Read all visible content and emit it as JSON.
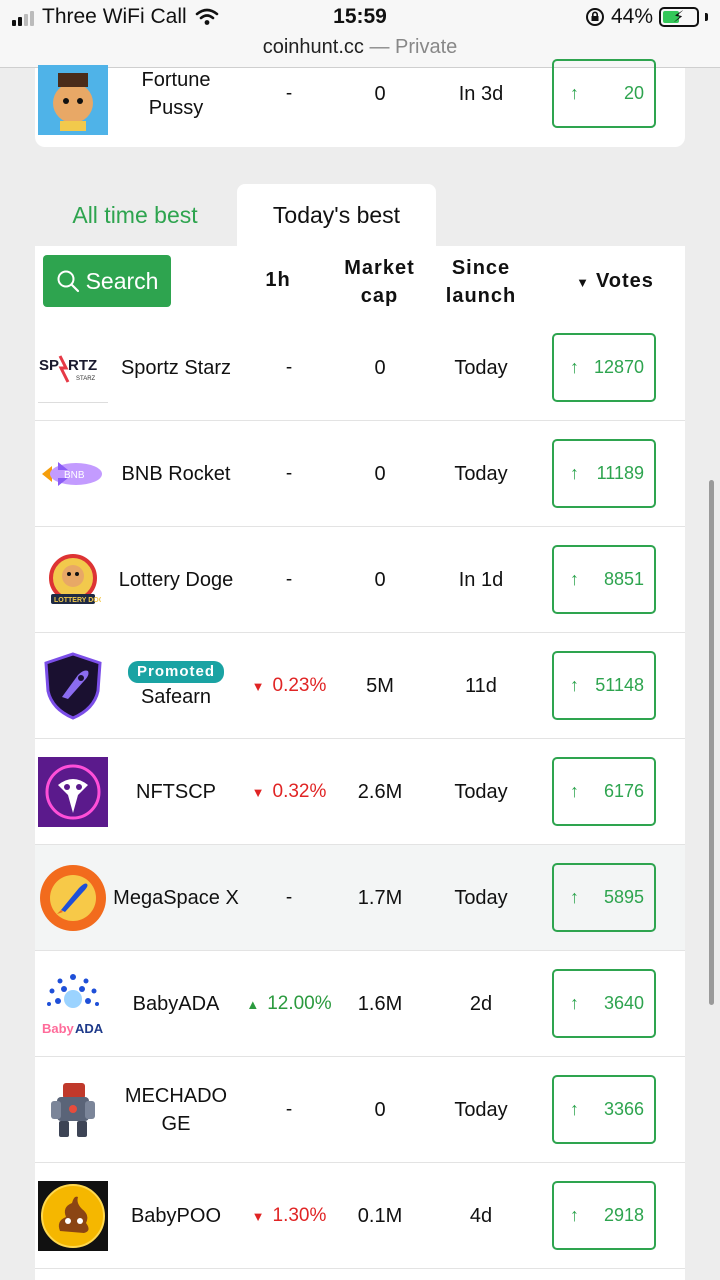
{
  "status": {
    "carrier": "Three WiFi Call",
    "time": "15:59",
    "battery": "44%"
  },
  "browser": {
    "domain": "coinhunt.cc",
    "separator": " — ",
    "mode": "Private"
  },
  "prev_row": {
    "name": "Fortune Pussy",
    "h1": "-",
    "market_cap": "0",
    "since_launch": "In 3d",
    "votes": "20"
  },
  "tabs": {
    "all_time": "All time best",
    "today": "Today's best"
  },
  "header": {
    "search": "Search",
    "h1": "1h",
    "market_cap": "Market cap",
    "since_launch": "Since launch",
    "votes_sort": "▼",
    "votes": "Votes"
  },
  "rows": [
    {
      "name": "Sportz Starz",
      "promoted": "",
      "h1": "-",
      "trend": "",
      "market_cap": "0",
      "since_launch": "Today",
      "votes": "12870",
      "logo": "sportz-starz-logo"
    },
    {
      "name": "BNB Rocket",
      "promoted": "",
      "h1": "-",
      "trend": "",
      "market_cap": "0",
      "since_launch": "Today",
      "votes": "11189",
      "logo": "bnb-rocket-logo"
    },
    {
      "name": "Lottery Doge",
      "promoted": "",
      "h1": "-",
      "trend": "",
      "market_cap": "0",
      "since_launch": "In 1d",
      "votes": "8851",
      "logo": "lottery-doge-logo"
    },
    {
      "name": "Safearn",
      "promoted": "Promoted",
      "h1": "0.23%",
      "trend": "down",
      "market_cap": "5M",
      "since_launch": "11d",
      "votes": "51148",
      "logo": "safearn-logo"
    },
    {
      "name": "NFTSCP",
      "promoted": "",
      "h1": "0.32%",
      "trend": "down",
      "market_cap": "2.6M",
      "since_launch": "Today",
      "votes": "6176",
      "logo": "nftscp-logo"
    },
    {
      "name": "MegaSpace X",
      "promoted": "",
      "h1": "-",
      "trend": "",
      "market_cap": "1.7M",
      "since_launch": "Today",
      "votes": "5895",
      "logo": "megaspacex-logo"
    },
    {
      "name": "BabyADA",
      "promoted": "",
      "h1": "12.00%",
      "trend": "up",
      "market_cap": "1.6M",
      "since_launch": "2d",
      "votes": "3640",
      "logo": "babyada-logo"
    },
    {
      "name": "MECHADOGE",
      "promoted": "",
      "h1": "-",
      "trend": "",
      "market_cap": "0",
      "since_launch": "Today",
      "votes": "3366",
      "logo": "mechadoge-logo"
    },
    {
      "name": "BabyPOO",
      "promoted": "",
      "h1": "1.30%",
      "trend": "down",
      "market_cap": "0.1M",
      "since_launch": "4d",
      "votes": "2918",
      "logo": "babypoo-logo"
    }
  ],
  "colors": {
    "accent": "#2ea44f",
    "down": "#e02424",
    "up": "#2b9a3e",
    "promoted": "#1aa3a3"
  }
}
